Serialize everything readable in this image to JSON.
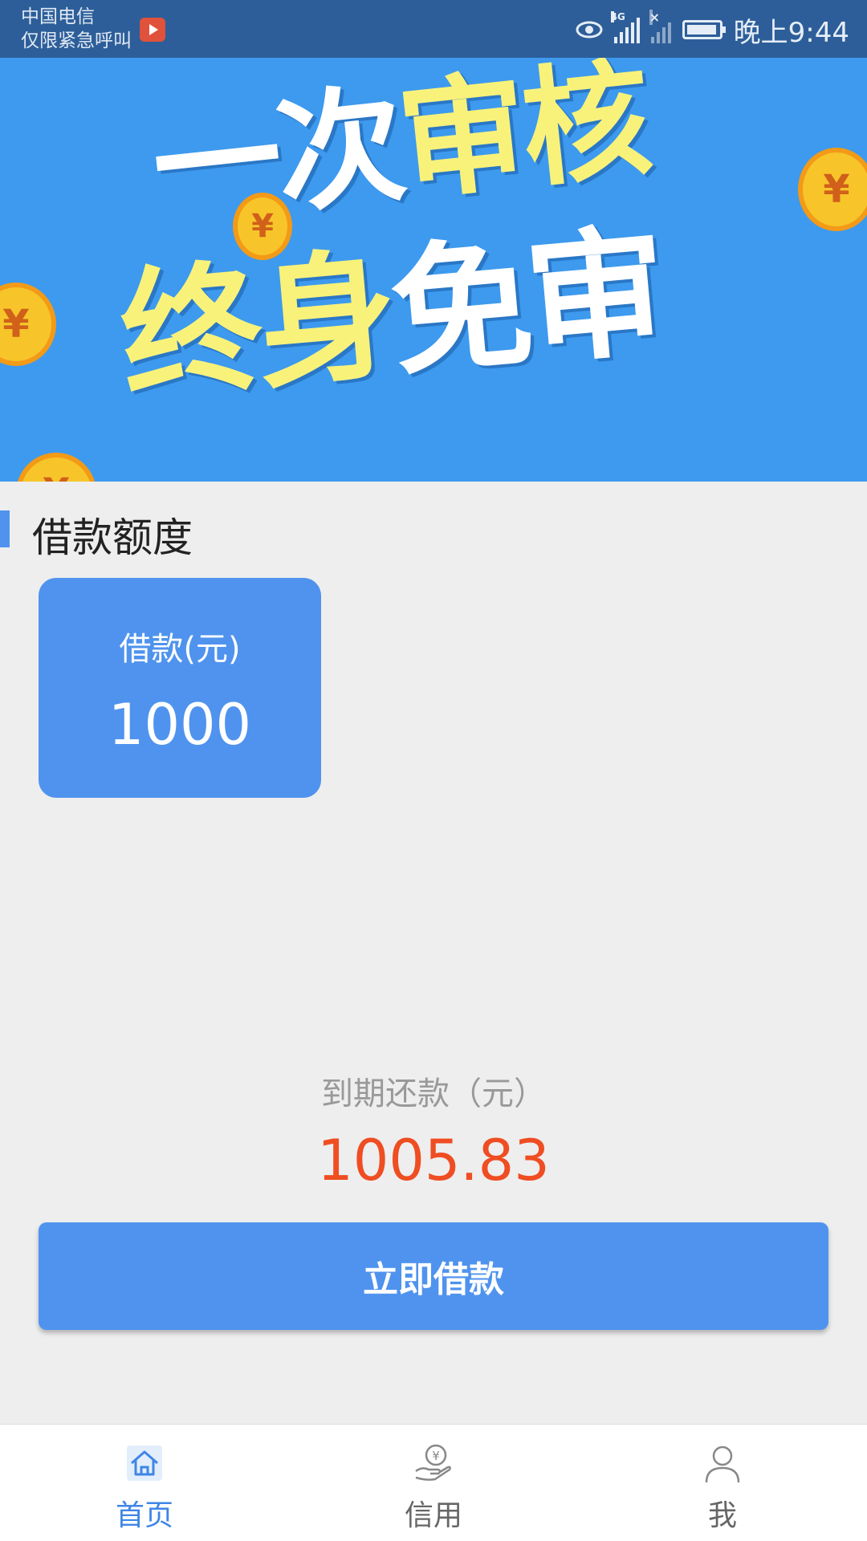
{
  "status_bar": {
    "carrier": "中国电信",
    "emergency": "仅限紧急呼叫",
    "network": "4G",
    "time": "晚上9:44"
  },
  "banner": {
    "line1_a": "一次",
    "line1_b": "审核",
    "line2_a": "终身",
    "line2_b": "免审",
    "coin_symbol": "¥"
  },
  "section": {
    "title": "借款额度"
  },
  "loan_card": {
    "label": "借款(元)",
    "amount": "1000"
  },
  "due": {
    "label": "到期还款（元）",
    "amount": "1005.83"
  },
  "action": {
    "borrow_label": "立即借款"
  },
  "nav": {
    "items": [
      {
        "label": "首页",
        "icon": "home-icon",
        "active": true
      },
      {
        "label": "信用",
        "icon": "credit-hand-icon",
        "active": false
      },
      {
        "label": "我",
        "icon": "user-icon",
        "active": false
      }
    ]
  },
  "colors": {
    "primary": "#4f93ee",
    "due_amount": "#ef4d22",
    "banner_bg": "#3d9aee",
    "banner_yellow": "#f9f27a",
    "status_bar": "#2d5e99"
  }
}
